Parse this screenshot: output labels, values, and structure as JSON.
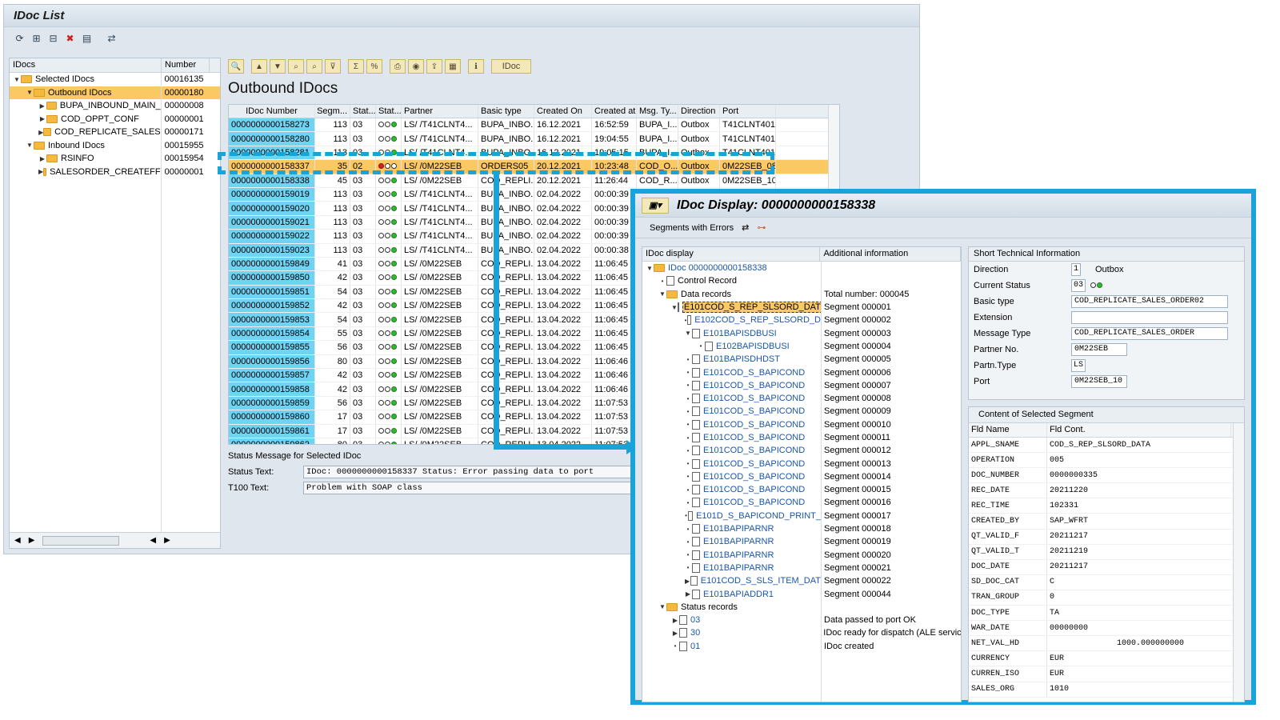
{
  "window": {
    "title": "IDoc List"
  },
  "toolbar_icons": [
    "refresh-icon",
    "expand-icon",
    "collapse-icon",
    "delete-icon",
    "document-icon",
    "transfer-icon"
  ],
  "tree": {
    "headers": [
      "IDocs",
      "Number"
    ],
    "rows": [
      {
        "label": "Selected IDocs",
        "count": "00016135",
        "level": 0,
        "expand": "▼"
      },
      {
        "label": "Outbound IDocs",
        "count": "00000180",
        "level": 1,
        "expand": "▼",
        "selected": true
      },
      {
        "label": "BUPA_INBOUND_MAIN_",
        "count": "00000008",
        "level": 2,
        "expand": "▶"
      },
      {
        "label": "COD_OPPT_CONF",
        "count": "00000001",
        "level": 2,
        "expand": "▶"
      },
      {
        "label": "COD_REPLICATE_SALES",
        "count": "00000171",
        "level": 2,
        "expand": "▶"
      },
      {
        "label": "Inbound IDocs",
        "count": "00015955",
        "level": 1,
        "expand": "▼"
      },
      {
        "label": "RSINFO",
        "count": "00015954",
        "level": 2,
        "expand": "▶"
      },
      {
        "label": "SALESORDER_CREATEFF",
        "count": "00000001",
        "level": 2,
        "expand": "▶"
      }
    ]
  },
  "main": {
    "heading": "Outbound IDocs",
    "toolbar_idoc": "IDoc",
    "columns": [
      "IDoc Number",
      "Segm...",
      "Stat...",
      "Stat...",
      "Partner",
      "Basic type",
      "Created On",
      "Created at",
      "Msg. Ty...",
      "Direction",
      "Port"
    ],
    "rows": [
      [
        "0000000000158273",
        "113",
        "03",
        "ok",
        "LS/ /T41CLNT4...",
        "BUPA_INBO...",
        "16.12.2021",
        "16:52:59",
        "BUPA_I...",
        "Outbox",
        "T41CLNT401"
      ],
      [
        "0000000000158280",
        "113",
        "03",
        "ok",
        "LS/ /T41CLNT4...",
        "BUPA_INBO...",
        "16.12.2021",
        "19:04:55",
        "BUPA_I...",
        "Outbox",
        "T41CLNT401"
      ],
      [
        "0000000000158281",
        "113",
        "03",
        "ok",
        "LS/ /T41CLNT4...",
        "BUPA_INBO...",
        "16.12.2021",
        "19:05:15",
        "BUPA_I...",
        "Outbox",
        "T41CLNT401"
      ],
      [
        "0000000000158337",
        "35",
        "02",
        "err",
        "LS/ /0M22SEB",
        "ORDERS05",
        "20.12.2021",
        "10:23:48",
        "COD_O...",
        "Outbox",
        "0M22SEB_08"
      ],
      [
        "0000000000158338",
        "45",
        "03",
        "ok",
        "LS/ /0M22SEB",
        "COD_REPLI...",
        "20.12.2021",
        "11:26:44",
        "COD_R...",
        "Outbox",
        "0M22SEB_10"
      ],
      [
        "0000000000159019",
        "113",
        "03",
        "ok",
        "LS/ /T41CLNT4...",
        "BUPA_INBO...",
        "02.04.2022",
        "00:00:39",
        "",
        "",
        ""
      ],
      [
        "0000000000159020",
        "113",
        "03",
        "ok",
        "LS/ /T41CLNT4...",
        "BUPA_INBO...",
        "02.04.2022",
        "00:00:39",
        "",
        "",
        ""
      ],
      [
        "0000000000159021",
        "113",
        "03",
        "ok",
        "LS/ /T41CLNT4...",
        "BUPA_INBO...",
        "02.04.2022",
        "00:00:39",
        "",
        "",
        ""
      ],
      [
        "0000000000159022",
        "113",
        "03",
        "ok",
        "LS/ /T41CLNT4...",
        "BUPA_INBO...",
        "02.04.2022",
        "00:00:39",
        "",
        "",
        ""
      ],
      [
        "0000000000159023",
        "113",
        "03",
        "ok",
        "LS/ /T41CLNT4...",
        "BUPA_INBO...",
        "02.04.2022",
        "00:00:38",
        "",
        "",
        ""
      ],
      [
        "0000000000159849",
        "41",
        "03",
        "ok",
        "LS/ /0M22SEB",
        "COD_REPLI...",
        "13.04.2022",
        "11:06:45",
        "",
        "",
        ""
      ],
      [
        "0000000000159850",
        "42",
        "03",
        "ok",
        "LS/ /0M22SEB",
        "COD_REPLI...",
        "13.04.2022",
        "11:06:45",
        "",
        "",
        ""
      ],
      [
        "0000000000159851",
        "54",
        "03",
        "ok",
        "LS/ /0M22SEB",
        "COD_REPLI...",
        "13.04.2022",
        "11:06:45",
        "",
        "",
        ""
      ],
      [
        "0000000000159852",
        "42",
        "03",
        "ok",
        "LS/ /0M22SEB",
        "COD_REPLI...",
        "13.04.2022",
        "11:06:45",
        "",
        "",
        ""
      ],
      [
        "0000000000159853",
        "54",
        "03",
        "ok",
        "LS/ /0M22SEB",
        "COD_REPLI...",
        "13.04.2022",
        "11:06:45",
        "",
        "",
        ""
      ],
      [
        "0000000000159854",
        "55",
        "03",
        "ok",
        "LS/ /0M22SEB",
        "COD_REPLI...",
        "13.04.2022",
        "11:06:45",
        "",
        "",
        ""
      ],
      [
        "0000000000159855",
        "56",
        "03",
        "ok",
        "LS/ /0M22SEB",
        "COD_REPLI...",
        "13.04.2022",
        "11:06:45",
        "",
        "",
        ""
      ],
      [
        "0000000000159856",
        "80",
        "03",
        "ok",
        "LS/ /0M22SEB",
        "COD_REPLI...",
        "13.04.2022",
        "11:06:46",
        "",
        "",
        ""
      ],
      [
        "0000000000159857",
        "42",
        "03",
        "ok",
        "LS/ /0M22SEB",
        "COD_REPLI...",
        "13.04.2022",
        "11:06:46",
        "",
        "",
        ""
      ],
      [
        "0000000000159858",
        "42",
        "03",
        "ok",
        "LS/ /0M22SEB",
        "COD_REPLI...",
        "13.04.2022",
        "11:06:46",
        "",
        "",
        ""
      ],
      [
        "0000000000159859",
        "56",
        "03",
        "ok",
        "LS/ /0M22SEB",
        "COD_REPLI...",
        "13.04.2022",
        "11:07:53",
        "",
        "",
        ""
      ],
      [
        "0000000000159860",
        "17",
        "03",
        "ok",
        "LS/ /0M22SEB",
        "COD_REPLI...",
        "13.04.2022",
        "11:07:53",
        "",
        "",
        ""
      ],
      [
        "0000000000159861",
        "17",
        "03",
        "ok",
        "LS/ /0M22SEB",
        "COD_REPLI...",
        "13.04.2022",
        "11:07:53",
        "",
        "",
        ""
      ],
      [
        "0000000000159862",
        "80",
        "03",
        "ok",
        "LS/ /0M22SEB",
        "COD_REPLI...",
        "13.04.2022",
        "11:07:53",
        "",
        "",
        ""
      ]
    ],
    "highlight_index": 3,
    "status_caption": "Status Message for Selected IDoc",
    "status_text_label": "Status Text:",
    "status_text_value": "IDoc: 0000000000158337 Status: Error passing data to port",
    "t100_label": "T100 Text:",
    "t100_value": "Problem with SOAP class"
  },
  "popup": {
    "title": "IDoc Display: 0000000000158338",
    "toolbar_label": "Segments with Errors",
    "tree_headers": [
      "IDoc display",
      "Additional information"
    ],
    "tree_rows": [
      {
        "label": "IDoc 0000000000158338",
        "info": "",
        "indent": 0,
        "exp": "▼",
        "icon": "folder",
        "blue": true
      },
      {
        "label": "Control Record",
        "info": "",
        "indent": 1,
        "exp": "•",
        "icon": "doc"
      },
      {
        "label": "Data records",
        "info": "Total number: 000045",
        "indent": 1,
        "exp": "▼",
        "icon": "folder"
      },
      {
        "label": "E101COD_S_REP_SLSORD_DAT",
        "info": "Segment 000001",
        "indent": 2,
        "exp": "▼",
        "icon": "doc",
        "sel": true
      },
      {
        "label": "E102COD_S_REP_SLSORD_D",
        "info": "Segment 000002",
        "indent": 3,
        "exp": "•",
        "icon": "doc",
        "blue": true
      },
      {
        "label": "E101BAPISDBUSI",
        "info": "Segment 000003",
        "indent": 3,
        "exp": "▼",
        "icon": "doc",
        "blue": true
      },
      {
        "label": "E102BAPISDBUSI",
        "info": "Segment 000004",
        "indent": 4,
        "exp": "•",
        "icon": "doc",
        "blue": true
      },
      {
        "label": "E101BAPISDHDST",
        "info": "Segment 000005",
        "indent": 3,
        "exp": "•",
        "icon": "doc",
        "blue": true
      },
      {
        "label": "E101COD_S_BAPICOND",
        "info": "Segment 000006",
        "indent": 3,
        "exp": "•",
        "icon": "doc",
        "blue": true
      },
      {
        "label": "E101COD_S_BAPICOND",
        "info": "Segment 000007",
        "indent": 3,
        "exp": "•",
        "icon": "doc",
        "blue": true
      },
      {
        "label": "E101COD_S_BAPICOND",
        "info": "Segment 000008",
        "indent": 3,
        "exp": "•",
        "icon": "doc",
        "blue": true
      },
      {
        "label": "E101COD_S_BAPICOND",
        "info": "Segment 000009",
        "indent": 3,
        "exp": "•",
        "icon": "doc",
        "blue": true
      },
      {
        "label": "E101COD_S_BAPICOND",
        "info": "Segment 000010",
        "indent": 3,
        "exp": "•",
        "icon": "doc",
        "blue": true
      },
      {
        "label": "E101COD_S_BAPICOND",
        "info": "Segment 000011",
        "indent": 3,
        "exp": "•",
        "icon": "doc",
        "blue": true
      },
      {
        "label": "E101COD_S_BAPICOND",
        "info": "Segment 000012",
        "indent": 3,
        "exp": "•",
        "icon": "doc",
        "blue": true
      },
      {
        "label": "E101COD_S_BAPICOND",
        "info": "Segment 000013",
        "indent": 3,
        "exp": "•",
        "icon": "doc",
        "blue": true
      },
      {
        "label": "E101COD_S_BAPICOND",
        "info": "Segment 000014",
        "indent": 3,
        "exp": "•",
        "icon": "doc",
        "blue": true
      },
      {
        "label": "E101COD_S_BAPICOND",
        "info": "Segment 000015",
        "indent": 3,
        "exp": "•",
        "icon": "doc",
        "blue": true
      },
      {
        "label": "E101COD_S_BAPICOND",
        "info": "Segment 000016",
        "indent": 3,
        "exp": "•",
        "icon": "doc",
        "blue": true
      },
      {
        "label": "E101D_S_BAPICOND_PRINT_",
        "info": "Segment 000017",
        "indent": 3,
        "exp": "•",
        "icon": "doc",
        "blue": true
      },
      {
        "label": "E101BAPIPARNR",
        "info": "Segment 000018",
        "indent": 3,
        "exp": "•",
        "icon": "doc",
        "blue": true
      },
      {
        "label": "E101BAPIPARNR",
        "info": "Segment 000019",
        "indent": 3,
        "exp": "•",
        "icon": "doc",
        "blue": true
      },
      {
        "label": "E101BAPIPARNR",
        "info": "Segment 000020",
        "indent": 3,
        "exp": "•",
        "icon": "doc",
        "blue": true
      },
      {
        "label": "E101BAPIPARNR",
        "info": "Segment 000021",
        "indent": 3,
        "exp": "•",
        "icon": "doc",
        "blue": true
      },
      {
        "label": "E101COD_S_SLS_ITEM_DAT",
        "info": "Segment 000022",
        "indent": 3,
        "exp": "▶",
        "icon": "doc",
        "blue": true
      },
      {
        "label": "E101BAPIADDR1",
        "info": "Segment 000044",
        "indent": 3,
        "exp": "▶",
        "icon": "doc",
        "blue": true
      },
      {
        "label": "Status records",
        "info": "",
        "indent": 1,
        "exp": "▼",
        "icon": "folder"
      },
      {
        "label": "03",
        "info": "Data passed to port OK",
        "indent": 2,
        "exp": "▶",
        "icon": "doc",
        "blue": true
      },
      {
        "label": "30",
        "info": "IDoc ready for dispatch (ALE servic",
        "indent": 2,
        "exp": "▶",
        "icon": "doc",
        "blue": true
      },
      {
        "label": "01",
        "info": "IDoc created",
        "indent": 2,
        "exp": "•",
        "icon": "doc",
        "blue": true
      }
    ],
    "sti": {
      "header": "Short Technical Information",
      "direction_label": "Direction",
      "direction_code": "1",
      "direction_text": "Outbox",
      "status_label": "Current Status",
      "status_code": "03",
      "basic_type_label": "Basic type",
      "basic_type": "COD_REPLICATE_SALES_ORDER02",
      "extension_label": "Extension",
      "extension": "",
      "message_type_label": "Message Type",
      "message_type": "COD_REPLICATE_SALES_ORDER",
      "partner_no_label": "Partner No.",
      "partner_no": "0M22SEB",
      "partn_type_label": "Partn.Type",
      "partn_type": "LS",
      "port_label": "Port",
      "port": "0M22SEB_10"
    },
    "segment": {
      "header": "Content of Selected Segment",
      "col1": "Fld Name",
      "col2": "Fld Cont.",
      "rows": [
        [
          "APPL_SNAME",
          "COD_S_REP_SLSORD_DATA"
        ],
        [
          "OPERATION",
          "005"
        ],
        [
          "DOC_NUMBER",
          "0000000335"
        ],
        [
          "REC_DATE",
          "20211220"
        ],
        [
          "REC_TIME",
          "102331"
        ],
        [
          "CREATED_BY",
          "SAP_WFRT"
        ],
        [
          "QT_VALID_F",
          "20211217"
        ],
        [
          "QT_VALID_T",
          "20211219"
        ],
        [
          "DOC_DATE",
          "20211217"
        ],
        [
          "SD_DOC_CAT",
          "C"
        ],
        [
          "TRAN_GROUP",
          "0"
        ],
        [
          "DOC_TYPE",
          "TA"
        ],
        [
          "WAR_DATE",
          "00000000"
        ],
        [
          "NET_VAL_HD",
          "              1000.000000000"
        ],
        [
          "CURRENCY",
          "EUR"
        ],
        [
          "CURREN_ISO",
          "EUR"
        ],
        [
          "SALES_ORG",
          "1010"
        ]
      ]
    }
  }
}
